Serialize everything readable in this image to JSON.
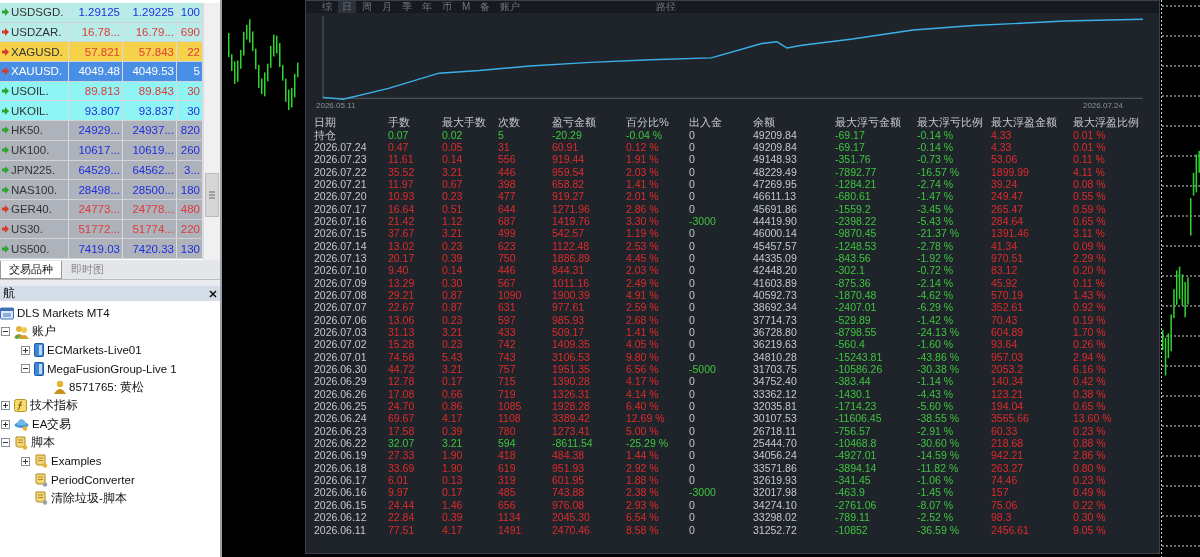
{
  "market_watch": {
    "quotes": [
      {
        "symbol": "USDSGD.",
        "bid": "1.29125",
        "ask": "1.29225",
        "spread": "100",
        "color": "#b8ece8",
        "rising": true,
        "price_up": true,
        "selected": false
      },
      {
        "symbol": "USDZAR.",
        "bid": "16.78...",
        "ask": "16.79...",
        "spread": "690",
        "color": "#b8ece8",
        "rising": false,
        "price_up": false,
        "selected": false
      },
      {
        "symbol": "XAGUSD.",
        "bid": "57.821",
        "ask": "57.843",
        "spread": "22",
        "color": "#f6d24a",
        "rising": false,
        "price_up": false,
        "selected": false
      },
      {
        "symbol": "XAUUSD.",
        "bid": "4049.48",
        "ask": "4049.53",
        "spread": "5",
        "color": "#4a8fe6",
        "rising": false,
        "selected": true
      },
      {
        "symbol": "USOIL.",
        "bid": "89.813",
        "ask": "89.843",
        "spread": "30",
        "color": "#8ef4f4",
        "rising": true,
        "price_up": false,
        "selected": false
      },
      {
        "symbol": "UKOIL.",
        "bid": "93.807",
        "ask": "93.837",
        "spread": "30",
        "color": "#8ef4f4",
        "rising": true,
        "price_up": true,
        "selected": false
      },
      {
        "symbol": "HK50.",
        "bid": "24929...",
        "ask": "24937...",
        "spread": "820",
        "color": "#aeb2ba",
        "rising": true,
        "price_up": true,
        "selected": false
      },
      {
        "symbol": "UK100.",
        "bid": "10617...",
        "ask": "10619...",
        "spread": "260",
        "color": "#aeb2ba",
        "rising": true,
        "price_up": true,
        "selected": false
      },
      {
        "symbol": "JPN225.",
        "bid": "64529...",
        "ask": "64562...",
        "spread": "3...",
        "color": "#aeb2ba",
        "rising": true,
        "price_up": true,
        "selected": false
      },
      {
        "symbol": "NAS100.",
        "bid": "28498...",
        "ask": "28500...",
        "spread": "180",
        "color": "#aeb2ba",
        "rising": true,
        "price_up": true,
        "selected": false
      },
      {
        "symbol": "GER40.",
        "bid": "24773...",
        "ask": "24778...",
        "spread": "480",
        "color": "#aeb2ba",
        "rising": false,
        "price_up": false,
        "selected": false
      },
      {
        "symbol": "US30.",
        "bid": "51772...",
        "ask": "51774...",
        "spread": "220",
        "color": "#aeb2ba",
        "rising": false,
        "price_up": false,
        "selected": false
      },
      {
        "symbol": "US500.",
        "bid": "7419.03",
        "ask": "7420.33",
        "spread": "130",
        "color": "#aeb2ba",
        "rising": true,
        "price_up": true,
        "selected": false
      }
    ],
    "tabs": [
      {
        "label": "交易品种",
        "selected": true
      },
      {
        "label": "即时图",
        "selected": false
      }
    ]
  },
  "navigator": {
    "title": "航",
    "tree": [
      {
        "label": "DLS Markets MT4",
        "kind": "terminal",
        "children": [
          {
            "label": "账户",
            "kind": "accounts",
            "expanded": true,
            "children": [
              {
                "label": "ECMarkets-Live01",
                "kind": "server",
                "expanded": false
              },
              {
                "label": "MegaFusionGroup-Live 1",
                "kind": "server",
                "expanded": true,
                "children": [
                  {
                    "label": "8571765: 黄松",
                    "kind": "user"
                  }
                ]
              }
            ]
          },
          {
            "label": "技术指标",
            "kind": "indicators",
            "expanded": false
          },
          {
            "label": "EA交易",
            "kind": "experts",
            "expanded": false
          },
          {
            "label": "脚本",
            "kind": "scripts",
            "expanded": true,
            "children": [
              {
                "label": "Examples",
                "kind": "scripts",
                "expanded": false
              },
              {
                "label": "PeriodConverter",
                "kind": "script"
              },
              {
                "label": "清除垃圾-脚本",
                "kind": "script"
              }
            ]
          }
        ]
      }
    ]
  },
  "report": {
    "periods": [
      {
        "label": "综",
        "selected": false
      },
      {
        "label": "日",
        "selected": true
      },
      {
        "label": "周",
        "selected": false
      },
      {
        "label": "月",
        "selected": false
      },
      {
        "label": "季",
        "selected": false
      },
      {
        "label": "年",
        "selected": false
      },
      {
        "label": "币",
        "selected": false
      },
      {
        "label": "M",
        "selected": false
      },
      {
        "label": "备",
        "selected": false
      },
      {
        "label": "账户",
        "selected": false
      }
    ],
    "path_label": "路径",
    "equity": {
      "start_label": "2026.05.11",
      "end_label": "2026.07.24"
    },
    "columns": [
      "日期",
      "手数",
      "最大手数",
      "次数",
      "盈亏金额",
      "百分比%",
      "出入金",
      "余额",
      "最大浮亏金额",
      "最大浮亏比例",
      "最大浮盈金额",
      "最大浮盈比例"
    ],
    "rows": [
      {
        "profit": false,
        "withdrawal": false,
        "cells": [
          "持仓",
          "0.07",
          "0.02",
          "5",
          "-20.29",
          "-0.04 %",
          "0",
          "49209.84",
          "-69.17",
          "-0.14 %",
          "4.33",
          "0.01 %"
        ]
      },
      {
        "profit": true,
        "withdrawal": false,
        "cells": [
          "2026.07.24",
          "0.47",
          "0.05",
          "31",
          "60.91",
          "0.12 %",
          "0",
          "49209.84",
          "-69.17",
          "-0.14 %",
          "4.33",
          "0.01 %"
        ]
      },
      {
        "profit": true,
        "withdrawal": false,
        "cells": [
          "2026.07.23",
          "11.61",
          "0.14",
          "556",
          "919.44",
          "1.91 %",
          "0",
          "49148.93",
          "-351.76",
          "-0.73 %",
          "53.06",
          "0.11 %"
        ]
      },
      {
        "profit": true,
        "withdrawal": false,
        "cells": [
          "2026.07.22",
          "35.52",
          "3.21",
          "446",
          "959.54",
          "2.03 %",
          "0",
          "48229.49",
          "-7892.77",
          "-16.57 %",
          "1899.99",
          "4.11 %"
        ]
      },
      {
        "profit": true,
        "withdrawal": false,
        "cells": [
          "2026.07.21",
          "11.97",
          "0.67",
          "398",
          "658.82",
          "1.41 %",
          "0",
          "47269.95",
          "-1284.21",
          "-2.74 %",
          "39.24",
          "0.08 %"
        ]
      },
      {
        "profit": true,
        "withdrawal": false,
        "cells": [
          "2026.07.20",
          "10.93",
          "0.23",
          "477",
          "919.27",
          "2.01 %",
          "0",
          "46611.13",
          "-680.61",
          "-1.47 %",
          "249.47",
          "0.55 %"
        ]
      },
      {
        "profit": true,
        "withdrawal": false,
        "cells": [
          "2026.07.17",
          "16.64",
          "0.51",
          "644",
          "1271.96",
          "2.86 %",
          "0",
          "45691.86",
          "-1559.2",
          "-3.45 %",
          "265.47",
          "0.59 %"
        ]
      },
      {
        "profit": true,
        "withdrawal": true,
        "cells": [
          "2026.07.16",
          "21.42",
          "1.12",
          "687",
          "1419.76",
          "3.30 %",
          "-3000",
          "44419.90",
          "-2398.22",
          "-5.43 %",
          "284.64",
          "0.65 %"
        ]
      },
      {
        "profit": true,
        "withdrawal": false,
        "cells": [
          "2026.07.15",
          "37.67",
          "3.21",
          "499",
          "542.57",
          "1.19 %",
          "0",
          "46000.14",
          "-9870.45",
          "-21.37 %",
          "1391.46",
          "3.11 %"
        ]
      },
      {
        "profit": true,
        "withdrawal": false,
        "cells": [
          "2026.07.14",
          "13.02",
          "0.23",
          "623",
          "1122.48",
          "2.53 %",
          "0",
          "45457.57",
          "-1248.53",
          "-2.78 %",
          "41.34",
          "0.09 %"
        ]
      },
      {
        "profit": true,
        "withdrawal": false,
        "cells": [
          "2026.07.13",
          "20.17",
          "0.39",
          "750",
          "1886.89",
          "4.45 %",
          "0",
          "44335.09",
          "-843.56",
          "-1.92 %",
          "970.51",
          "2.29 %"
        ]
      },
      {
        "profit": true,
        "withdrawal": false,
        "cells": [
          "2026.07.10",
          "9.40",
          "0.14",
          "446",
          "844.31",
          "2.03 %",
          "0",
          "42448.20",
          "-302.1",
          "-0.72 %",
          "83.12",
          "0.20 %"
        ]
      },
      {
        "profit": true,
        "withdrawal": false,
        "cells": [
          "2026.07.09",
          "13.29",
          "0.30",
          "567",
          "1011.16",
          "2.49 %",
          "0",
          "41603.89",
          "-875.36",
          "-2.14 %",
          "45.92",
          "0.11 %"
        ]
      },
      {
        "profit": true,
        "withdrawal": false,
        "cells": [
          "2026.07.08",
          "29.21",
          "0.87",
          "1090",
          "1900.39",
          "4.91 %",
          "0",
          "40592.73",
          "-1870.48",
          "-4.62 %",
          "570.19",
          "1.43 %"
        ]
      },
      {
        "profit": true,
        "withdrawal": false,
        "cells": [
          "2026.07.07",
          "22.67",
          "0.87",
          "631",
          "977.61",
          "2.59 %",
          "0",
          "38692.34",
          "-2407.01",
          "-6.29 %",
          "352.61",
          "0.92 %"
        ]
      },
      {
        "profit": true,
        "withdrawal": false,
        "cells": [
          "2026.07.06",
          "13.06",
          "0.23",
          "597",
          "985.93",
          "2.68 %",
          "0",
          "37714.73",
          "-529.89",
          "-1.42 %",
          "70.43",
          "0.19 %"
        ]
      },
      {
        "profit": true,
        "withdrawal": false,
        "cells": [
          "2026.07.03",
          "31.13",
          "3.21",
          "433",
          "509.17",
          "1.41 %",
          "0",
          "36728.80",
          "-8798.55",
          "-24.13 %",
          "604.89",
          "1.70 %"
        ]
      },
      {
        "profit": true,
        "withdrawal": false,
        "cells": [
          "2026.07.02",
          "15.28",
          "0.23",
          "742",
          "1409.35",
          "4.05 %",
          "0",
          "36219.63",
          "-560.4",
          "-1.60 %",
          "93.64",
          "0.26 %"
        ]
      },
      {
        "profit": true,
        "withdrawal": false,
        "cells": [
          "2026.07.01",
          "74.58",
          "5.43",
          "743",
          "3106.53",
          "9.80 %",
          "0",
          "34810.28",
          "-15243.81",
          "-43.86 %",
          "957.03",
          "2.94 %"
        ]
      },
      {
        "profit": true,
        "withdrawal": true,
        "cells": [
          "2026.06.30",
          "44.72",
          "3.21",
          "757",
          "1951.35",
          "6.56 %",
          "-5000",
          "31703.75",
          "-10586.26",
          "-30.38 %",
          "2053.2",
          "6.16 %"
        ]
      },
      {
        "profit": true,
        "withdrawal": false,
        "cells": [
          "2026.06.29",
          "12.78",
          "0.17",
          "715",
          "1390.28",
          "4.17 %",
          "0",
          "34752.40",
          "-383.44",
          "-1.14 %",
          "140.34",
          "0.42 %"
        ]
      },
      {
        "profit": true,
        "withdrawal": false,
        "cells": [
          "2026.06.26",
          "17.08",
          "0.66",
          "719",
          "1326.31",
          "4.14 %",
          "0",
          "33362.12",
          "-1430.1",
          "-4.43 %",
          "123.21",
          "0.38 %"
        ]
      },
      {
        "profit": true,
        "withdrawal": false,
        "cells": [
          "2026.06.25",
          "24.70",
          "0.86",
          "1085",
          "1928.28",
          "6.40 %",
          "0",
          "32035.81",
          "-1714.23",
          "-5.60 %",
          "194.04",
          "0.65 %"
        ]
      },
      {
        "profit": true,
        "withdrawal": false,
        "cells": [
          "2026.06.24",
          "69.67",
          "4.17",
          "1108",
          "3389.42",
          "12.69 %",
          "0",
          "30107.53",
          "-11606.45",
          "-38.55 %",
          "3565.66",
          "13.60 %"
        ]
      },
      {
        "profit": true,
        "withdrawal": false,
        "cells": [
          "2026.06.23",
          "17.58",
          "0.39",
          "780",
          "1273.41",
          "5.00 %",
          "0",
          "26718.11",
          "-756.57",
          "-2.91 %",
          "60.33",
          "0.23 %"
        ]
      },
      {
        "profit": false,
        "withdrawal": false,
        "cells": [
          "2026.06.22",
          "32.07",
          "3.21",
          "594",
          "-8611.54",
          "-25.29 %",
          "0",
          "25444.70",
          "-10468.8",
          "-30.60 %",
          "218.68",
          "0.88 %"
        ]
      },
      {
        "profit": true,
        "withdrawal": false,
        "cells": [
          "2026.06.19",
          "27.33",
          "1.90",
          "418",
          "484.38",
          "1.44 %",
          "0",
          "34056.24",
          "-4927.01",
          "-14.59 %",
          "942.21",
          "2.86 %"
        ]
      },
      {
        "profit": true,
        "withdrawal": false,
        "cells": [
          "2026.06.18",
          "33.69",
          "1.90",
          "619",
          "951.93",
          "2.92 %",
          "0",
          "33571.86",
          "-3894.14",
          "-11.82 %",
          "263.27",
          "0.80 %"
        ]
      },
      {
        "profit": true,
        "withdrawal": false,
        "cells": [
          "2026.06.17",
          "6.01",
          "0.13",
          "319",
          "601.95",
          "1.88 %",
          "0",
          "32619.93",
          "-341.45",
          "-1.06 %",
          "74.46",
          "0.23 %"
        ]
      },
      {
        "profit": true,
        "withdrawal": true,
        "cells": [
          "2026.06.16",
          "9.97",
          "0.17",
          "485",
          "743.88",
          "2.38 %",
          "-3000",
          "32017.98",
          "-463.9",
          "-1.45 %",
          "157",
          "0.49 %"
        ]
      },
      {
        "profit": true,
        "withdrawal": false,
        "cells": [
          "2026.06.15",
          "24.44",
          "1.46",
          "656",
          "976.08",
          "2.93 %",
          "0",
          "34274.10",
          "-2761.06",
          "-8.07 %",
          "75.06",
          "0.22 %"
        ]
      },
      {
        "profit": true,
        "withdrawal": false,
        "cells": [
          "2026.06.12",
          "22.84",
          "0.39",
          "1134",
          "2045.30",
          "6.54 %",
          "0",
          "33298.02",
          "-789.11",
          "-2.52 %",
          "98.3",
          "0.30 %"
        ]
      },
      {
        "profit": true,
        "withdrawal": false,
        "cells": [
          "2026.06.11",
          "77.51",
          "4.17",
          "1491",
          "2470.46",
          "8.58 %",
          "0",
          "31252.72",
          "-10852",
          "-36.59 %",
          "2456.61",
          "9.05 %"
        ]
      }
    ]
  }
}
